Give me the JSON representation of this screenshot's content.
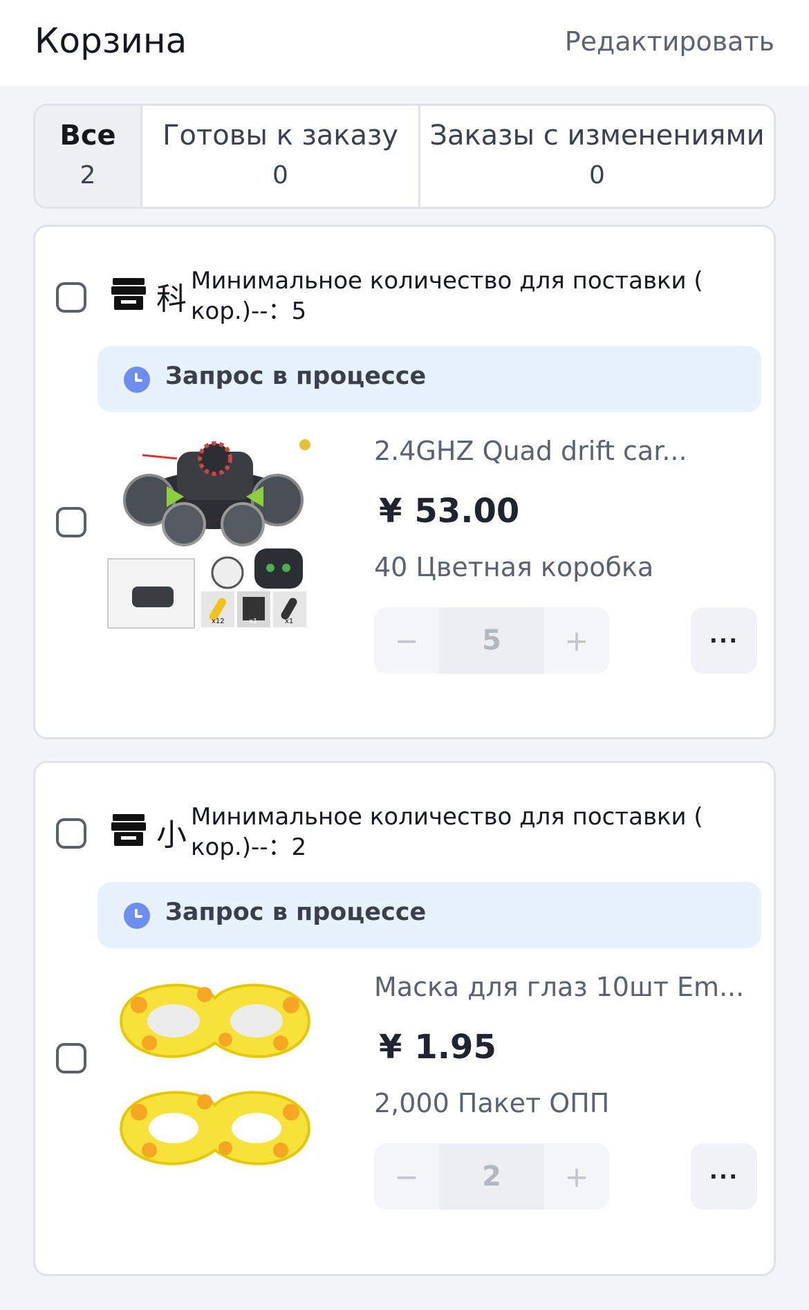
{
  "header": {
    "title": "Корзина",
    "edit_label": "Редактировать"
  },
  "tabs": [
    {
      "label": "Все",
      "count": "2"
    },
    {
      "label": "Готовы к заказу",
      "count": "0"
    },
    {
      "label": "Заказы с изменениями",
      "count": "0"
    }
  ],
  "shops": [
    {
      "name": "科",
      "moq_line1": "Минимальное количество для поставки (",
      "moq_line2": "кор.)--：5",
      "status": "Запрос в процессе",
      "item": {
        "name": "2.4GHZ Quad drift car...",
        "currency": "¥",
        "price": "53.00",
        "spec": "40 Цветная коробка",
        "quantity": "5",
        "minus": "−",
        "plus": "+",
        "more": "···",
        "image_labels": [
          "x12",
          "x1",
          "x1"
        ]
      }
    },
    {
      "name": "小",
      "moq_line1": "Минимальное количество для поставки (",
      "moq_line2": "кор.)--：2",
      "status": "Запрос в процессе",
      "item": {
        "name": "Маска для глаз 10шт Em...",
        "currency": "¥",
        "price": "1.95",
        "spec": "2,000 Пакет ОПП",
        "quantity": "2",
        "minus": "−",
        "plus": "+",
        "more": "···"
      }
    }
  ],
  "colors": {
    "accent": "#6d8ef0",
    "notice_bg": "#e8f2fd",
    "page_bg": "#f2f4f8"
  }
}
